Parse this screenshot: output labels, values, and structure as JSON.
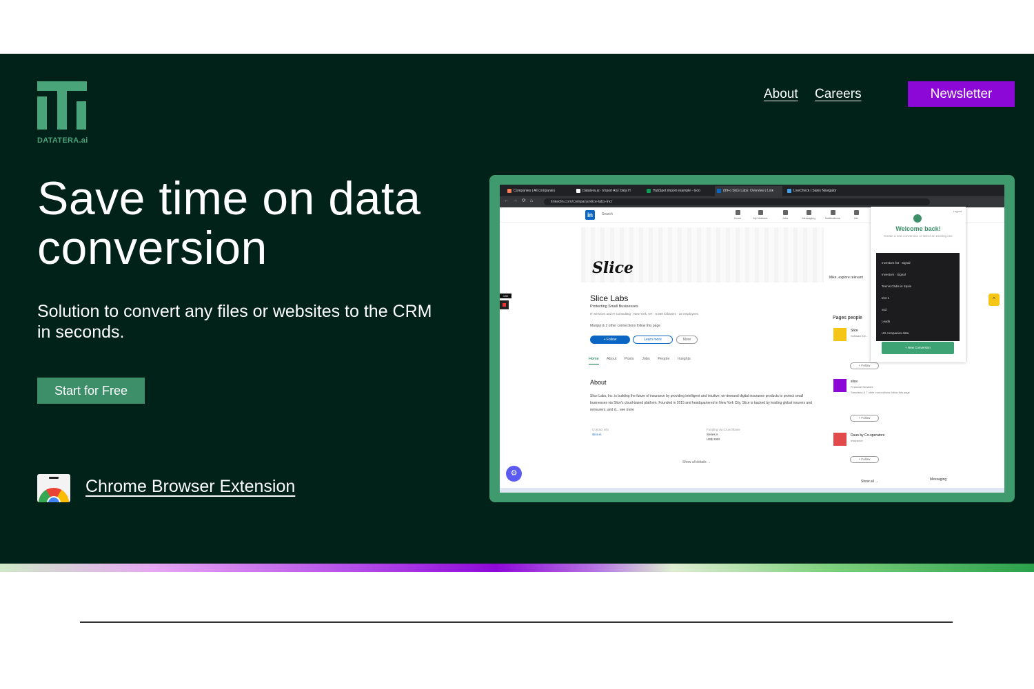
{
  "brand": {
    "logo_text": "DATATERA.ai",
    "accent": "#3c8f68",
    "purple": "#8c08d6",
    "bg": "#012219"
  },
  "nav": {
    "about": "About",
    "careers": "Careers",
    "newsletter": "Newsletter"
  },
  "hero": {
    "headline": "Save time on data conversion",
    "subhead": "Solution to convert any files or websites to the CRM in seconds.",
    "cta": "Start for Free",
    "extension_link": "Chrome Browser Extension"
  },
  "screenshot": {
    "tabs": [
      "Companies | All companies",
      "Datatera.ai · Import Any Data H",
      "HubSpot import example - Goo",
      "(99+) Slice Labs: Overview | Link",
      "LiveCheck | Sales Navigator"
    ],
    "url": "linkedin.com/company/slice-labs-inc/",
    "li_search": "Search",
    "li_nav": [
      "Home",
      "My Network",
      "Jobs",
      "Messaging",
      "Notifications",
      "Me"
    ],
    "cover_word": "Slice",
    "company": {
      "name": "Slice Labs",
      "tagline": "Protecting Small Businesses",
      "meta": "IT Services and IT Consulting · New York, NY · 6,569 followers · 33 employees",
      "connections": "Marijan & 2 other connections follow this page",
      "follow": "+ Follow",
      "learn_more": "Learn more",
      "more": "More"
    },
    "tabs_li": [
      "Home",
      "About",
      "Posts",
      "Jobs",
      "People",
      "Insights"
    ],
    "about_heading": "About",
    "about_text": "Slice Labs, Inc. is building the future of insurance by providing intelligent and intuitive, on-demand digital insurance products to protect small businesses via Slice's cloud-based platform. Founded in 2015 and headquartered in New York City, Slice is backed by leading global insurers and reinsurers, and d... see more",
    "info": {
      "contact_label": "Contact info",
      "contact_value": "slice.is",
      "funding_label": "Funding via Crunchbase",
      "series": "Series A",
      "amount": "US$ 20M"
    },
    "show_all_details": "Show all details →",
    "side_note": "Mike, explore relevant",
    "pages_people": "Pages people",
    "companies": [
      {
        "name": "Slice",
        "sub": "Software De...",
        "follow": "+ Follow"
      },
      {
        "name": "slice",
        "sub": "Financial Services",
        "extra": "Saradana & 7 other connections follow this page",
        "follow": "+ Follow"
      },
      {
        "name": "Duuo by Co-operators",
        "sub": "Insurance",
        "follow": "+ Follow"
      }
    ],
    "show_all": "Show all →",
    "messaging": "Messaging",
    "rec_time": "4:50",
    "ext": {
      "logout": "Logout",
      "welcome": "Welcome back!",
      "welcome_sub": "Create a new conversion or select an existing one",
      "items": [
        "Investors list · Signal",
        "Investors · Signal",
        "Tennis Clubs in Spain",
        "test 1",
        "xsd",
        "Leads",
        "US companies data"
      ],
      "new_conversion": "+ New Conversion"
    }
  }
}
